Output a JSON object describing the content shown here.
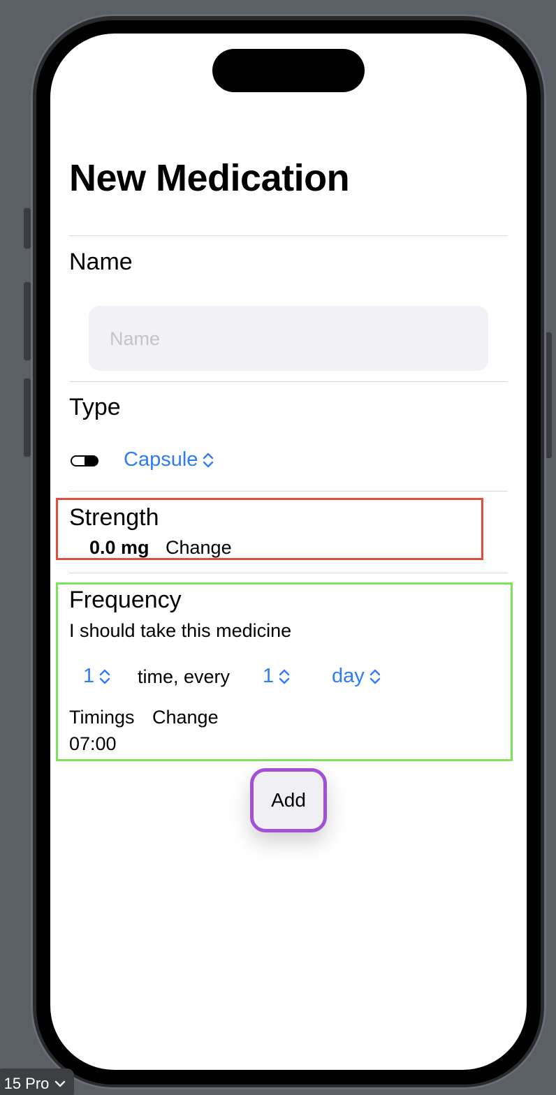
{
  "device_selector": {
    "label": "15 Pro",
    "icon": "chevron-down-icon"
  },
  "page": {
    "title": "New Medication"
  },
  "name_section": {
    "label": "Name",
    "field_value": "",
    "field_placeholder": "Name"
  },
  "type_section": {
    "label": "Type",
    "icon": "capsule-icon",
    "selected": "Capsule"
  },
  "strength_section": {
    "label": "Strength",
    "value": "0.0 mg",
    "change_label": "Change"
  },
  "frequency_section": {
    "label": "Frequency",
    "description": "I should take this medicine",
    "times_value": "1",
    "times_text": "time, every",
    "interval_value": "1",
    "interval_unit": "day",
    "timings_label": "Timings",
    "timings_change_label": "Change",
    "timings_value": "07:00"
  },
  "add_button": {
    "label": "Add"
  },
  "colors": {
    "accent": "#2f7cf6",
    "highlight_strength": "#e24c3b",
    "highlight_frequency": "#7ee35a",
    "highlight_add": "#a250d6"
  }
}
